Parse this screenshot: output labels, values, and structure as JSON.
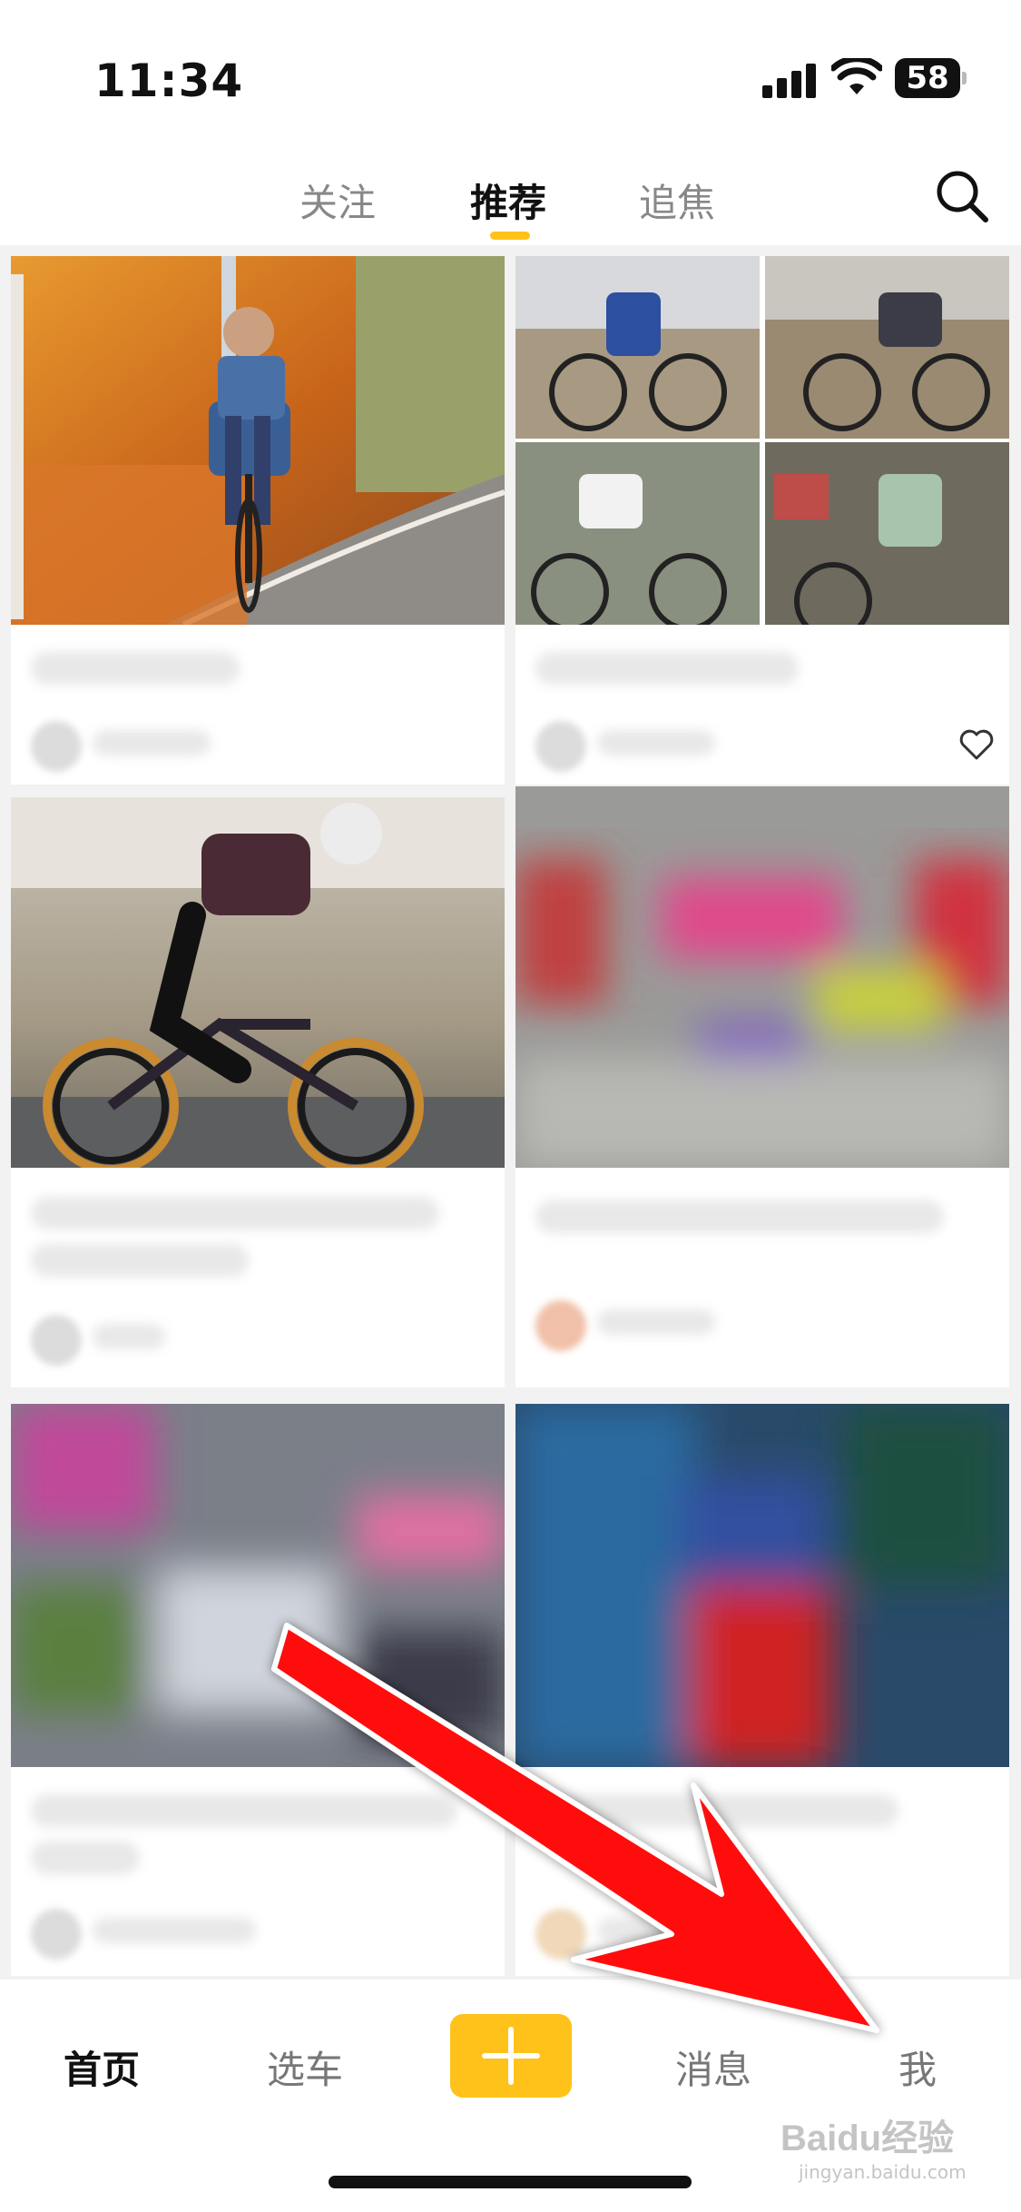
{
  "status_bar": {
    "time": "11:34",
    "battery": "58",
    "icons": [
      "signal-icon",
      "wifi-icon",
      "battery-icon"
    ]
  },
  "top_tabs": {
    "items": [
      {
        "label": "关注",
        "active": false
      },
      {
        "label": "推荐",
        "active": true
      },
      {
        "label": "追焦",
        "active": false
      }
    ],
    "accent_color": "#ffc21a",
    "search_icon": "search-icon"
  },
  "feed": {
    "cards": [
      {
        "image": "cyclist-autumn-road-photo",
        "title": "",
        "author": "",
        "likes": ""
      },
      {
        "image": "cyclists-collage-photo",
        "title": "",
        "author": "",
        "likes": "",
        "like_icon": "heart-icon"
      },
      {
        "image": "road-cyclist-speed-photo",
        "title": "",
        "author": "",
        "likes": ""
      },
      {
        "image": "blurred-photo",
        "title": "",
        "author": "",
        "likes": ""
      },
      {
        "image": "blurred-photo",
        "title": "",
        "author": "",
        "likes": ""
      },
      {
        "image": "blurred-photo",
        "title": "",
        "author": "",
        "likes": ""
      }
    ]
  },
  "bottom_nav": {
    "items": [
      {
        "label": "首页",
        "active": true
      },
      {
        "label": "选车",
        "active": false
      },
      {
        "label": "消息",
        "active": false
      },
      {
        "label": "我",
        "active": false
      }
    ],
    "plus_icon": "plus-icon",
    "accent_color": "#ffc21a"
  },
  "watermark": {
    "text": "Baidu经验",
    "sub": "jingyan.baidu.com"
  },
  "annotation": {
    "arrow_color": "#ff1010",
    "arrow_icon": "red-arrow-annotation"
  }
}
